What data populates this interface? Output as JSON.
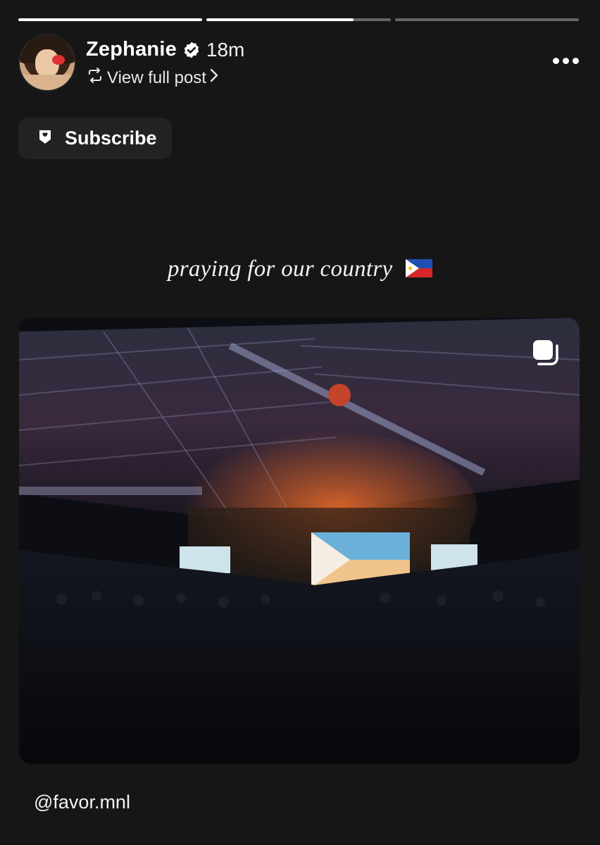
{
  "story": {
    "progress": [
      1.0,
      0.8,
      0.0
    ]
  },
  "header": {
    "username": "Zephanie",
    "verified": true,
    "time": "18m",
    "view_full_post": "View full post",
    "icons": [
      "verified-badge-icon",
      "repost-icon",
      "chevron-right-icon",
      "more-icon"
    ]
  },
  "subscribe": {
    "label": "Subscribe",
    "icon": "subscribe-badge-icon"
  },
  "caption": {
    "text": "praying for our country",
    "emoji": "philippine-flag-icon"
  },
  "photo": {
    "icon": "multiple-posts-icon"
  },
  "mention": {
    "text": "@favor.mnl"
  },
  "colors": {
    "background": "#161616",
    "button": "#222222",
    "text": "#ffffff"
  }
}
